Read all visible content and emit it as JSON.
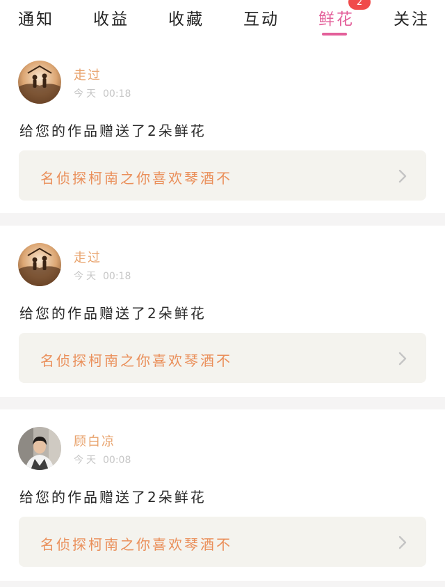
{
  "tabs": {
    "items": [
      {
        "label": "通知"
      },
      {
        "label": "收益"
      },
      {
        "label": "收藏"
      },
      {
        "label": "互动"
      },
      {
        "label": "鲜花",
        "badge": "2"
      },
      {
        "label": "关注"
      }
    ],
    "active": "鲜花"
  },
  "notifications": [
    {
      "username": "走过",
      "day": "今天",
      "time": "00:18",
      "message": "给您的作品赠送了2朵鲜花",
      "work_title": "名侦探柯南之你喜欢琴酒不",
      "avatar": "silhouette-couple-avatar"
    },
    {
      "username": "走过",
      "day": "今天",
      "time": "00:18",
      "message": "给您的作品赠送了2朵鲜花",
      "work_title": "名侦探柯南之你喜欢琴酒不",
      "avatar": "silhouette-couple-avatar"
    },
    {
      "username": "顾白凉",
      "day": "今天",
      "time": "00:08",
      "message": "给您的作品赠送了2朵鲜花",
      "work_title": "名侦探柯南之你喜欢琴酒不",
      "avatar": "person-photo-avatar"
    }
  ],
  "colors": {
    "accent": "#e35f9a",
    "badge": "#f04b4b",
    "username": "#e8a36d",
    "work_title": "#ea8f5a",
    "work_box_bg": "#f4f3ee",
    "separator": "#f5f4f4"
  },
  "icons": {
    "chevron": "chevron-right-icon"
  }
}
